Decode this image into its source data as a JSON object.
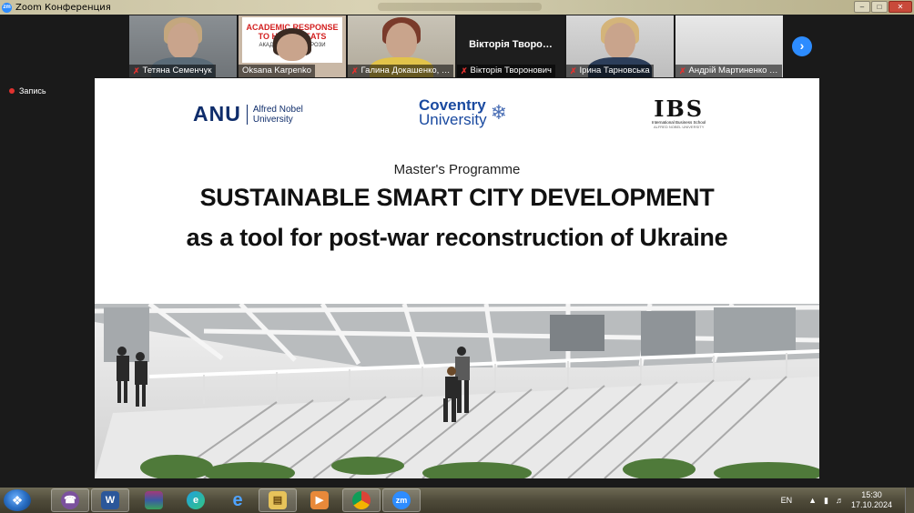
{
  "window": {
    "title": "Zoom Конференция"
  },
  "participants": [
    {
      "name": "Тетяна Семенчук"
    },
    {
      "name": "Oksana Karpenko",
      "banner_line1": "ACADEMIC RESPONSE",
      "banner_line2": "TO H… THREATS",
      "banner_line3": "АКАДЕМІЧ… НІ ЗАГРОЗИ"
    },
    {
      "name": "Галина Докашенко, …"
    },
    {
      "name": "Вікторія Творонович",
      "display": "Вікторія Творо…"
    },
    {
      "name": "Ірина Тарновська"
    },
    {
      "name": "Андрій Мартиненко …"
    }
  ],
  "record_label": "Запись",
  "slide": {
    "logos": {
      "anu_mark": "ANU",
      "anu_line1": "Alfred Nobel",
      "anu_line2": "University",
      "coventry_line1": "Coventry",
      "coventry_line2": "University",
      "ibs_mark": "IBS",
      "ibs_sub": "International Business School",
      "ibs_sub2": "ALFRED NOBEL UNIVERSITY"
    },
    "programme": "Master's Programme",
    "title_line1": "SUSTAINABLE SMART CITY DEVELOPMENT",
    "title_line2": "as a tool for post-war reconstruction of Ukraine"
  },
  "taskbar": {
    "apps": [
      {
        "icon": "viber-icon"
      },
      {
        "icon": "word-icon"
      },
      {
        "icon": "winrar-icon"
      },
      {
        "icon": "edge-icon"
      },
      {
        "icon": "ie-icon"
      },
      {
        "icon": "explorer-icon"
      },
      {
        "icon": "media-player-icon"
      },
      {
        "icon": "chrome-icon"
      },
      {
        "icon": "zoom-icon"
      }
    ],
    "language": "EN",
    "time": "15:30",
    "date": "17.10.2024"
  }
}
